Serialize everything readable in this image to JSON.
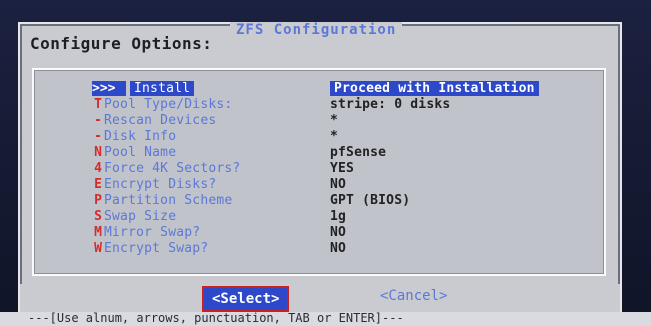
{
  "dialog": {
    "title": "ZFS Configuration",
    "prompt": "Configure Options:"
  },
  "menu": {
    "items": [
      {
        "hotkey": ">>>",
        "label": "Install",
        "value": "Proceed with Installation",
        "selected": true
      },
      {
        "hotkey": "T",
        "label": "Pool Type/Disks:",
        "value": "stripe: 0 disks"
      },
      {
        "hotkey": "-",
        "label": "Rescan Devices",
        "value": "*"
      },
      {
        "hotkey": "-",
        "label": "Disk Info",
        "value": "*"
      },
      {
        "hotkey": "N",
        "label": "Pool Name",
        "value": "pfSense"
      },
      {
        "hotkey": "4",
        "label": "Force 4K Sectors?",
        "value": "YES"
      },
      {
        "hotkey": "E",
        "label": "Encrypt Disks?",
        "value": "NO"
      },
      {
        "hotkey": "P",
        "label": "Partition Scheme",
        "value": "GPT (BIOS)"
      },
      {
        "hotkey": "S",
        "label": "Swap Size",
        "value": "1g"
      },
      {
        "hotkey": "M",
        "label": "Mirror Swap?",
        "value": "NO"
      },
      {
        "hotkey": "W",
        "label": "Encrypt Swap?",
        "value": "NO"
      }
    ]
  },
  "buttons": {
    "select": "<Select>",
    "cancel": "<Cancel>"
  },
  "hint": "---[Use alnum, arrows, punctuation, TAB or ENTER]---"
}
